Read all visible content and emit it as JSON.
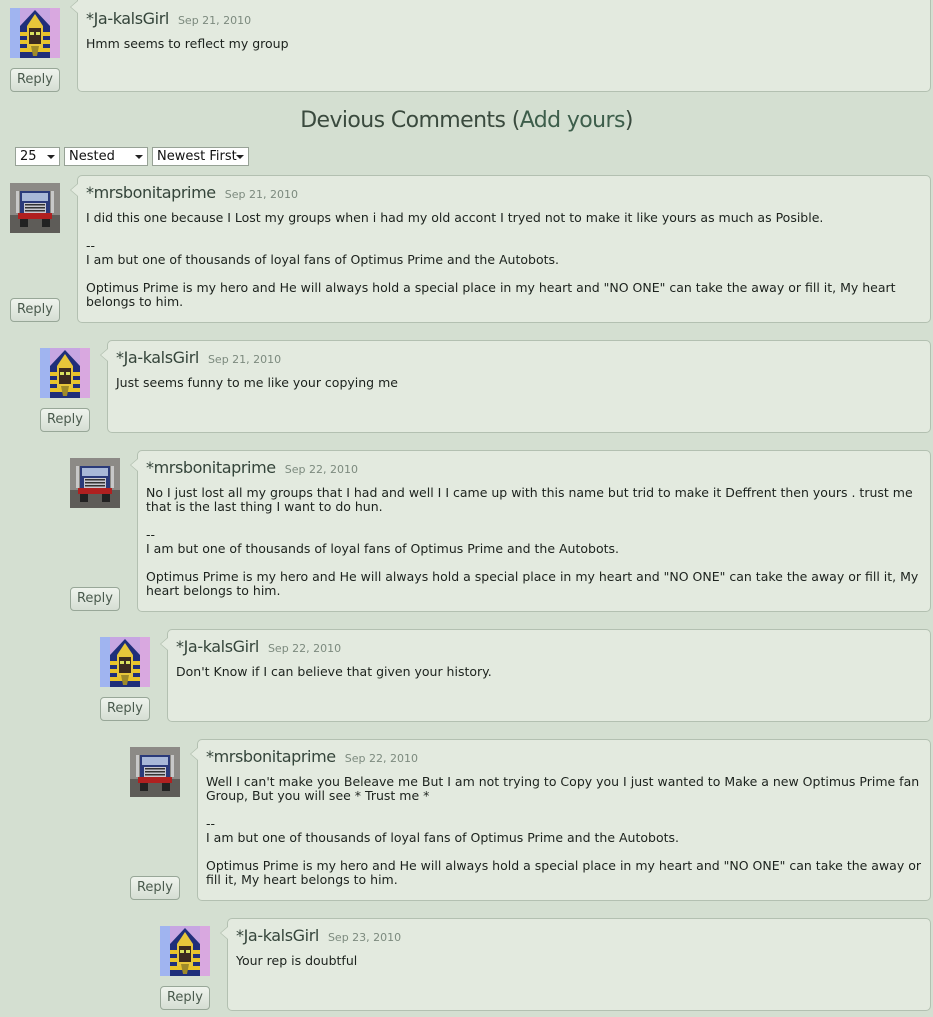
{
  "section": {
    "title": "Devious Comments",
    "add_link": "Add yours",
    "paren_open": "(",
    "paren_close": ")"
  },
  "controls": {
    "per_page": "25",
    "view_mode": "Nested",
    "sort_order": "Newest First"
  },
  "reply_label": "Reply",
  "avatars": {
    "ja_kals_girl": "pharaoh-avatar-icon",
    "mrsbonitaprime": "optimus-truck-avatar-icon"
  },
  "comments": [
    {
      "author": "*Ja-kalsGirl",
      "date": "Sep 21, 2010",
      "paragraphs": [
        "Hmm seems to reflect my group"
      ]
    },
    {
      "author": "*mrsbonitaprime",
      "date": "Sep 21, 2010",
      "paragraphs": [
        "I did this one because I Lost my groups when i had my old accont I tryed not to make it like yours as much as Posible.",
        "--",
        "I am but one of thousands of loyal fans of Optimus Prime and the Autobots.",
        "Optimus Prime is my hero and He will always hold a special place in my heart and \"NO ONE\" can take the away or fill it, My heart belongs to him."
      ]
    },
    {
      "author": "*Ja-kalsGirl",
      "date": "Sep 21, 2010",
      "paragraphs": [
        "Just seems funny to me like your copying me"
      ]
    },
    {
      "author": "*mrsbonitaprime",
      "date": "Sep 22, 2010",
      "paragraphs": [
        "No I just lost all my groups that I had and well I I came up with this name but trid to make it Deffrent then yours . trust me that is the last thing I want to do hun.",
        "--",
        "I am but one of thousands of loyal fans of Optimus Prime and the Autobots.",
        "Optimus Prime is my hero and He will always hold a special place in my heart and \"NO ONE\" can take the away or fill it, My heart belongs to him."
      ]
    },
    {
      "author": "*Ja-kalsGirl",
      "date": "Sep 22, 2010",
      "paragraphs": [
        "Don't Know if I can believe that given your history."
      ]
    },
    {
      "author": "*mrsbonitaprime",
      "date": "Sep 22, 2010",
      "paragraphs": [
        "Well I can't make you Beleave me But I am not trying to Copy you I just wanted to Make a new Optimus Prime fan Group, But you will see * Trust me *",
        "--",
        "I am but one of thousands of loyal fans of Optimus Prime and the Autobots.",
        "Optimus Prime is my hero and He will always hold a special place in my heart and \"NO ONE\" can take the away or fill it, My heart belongs to him."
      ]
    },
    {
      "author": "*Ja-kalsGirl",
      "date": "Sep 23, 2010",
      "paragraphs": [
        "Your rep is doubtful"
      ]
    }
  ]
}
